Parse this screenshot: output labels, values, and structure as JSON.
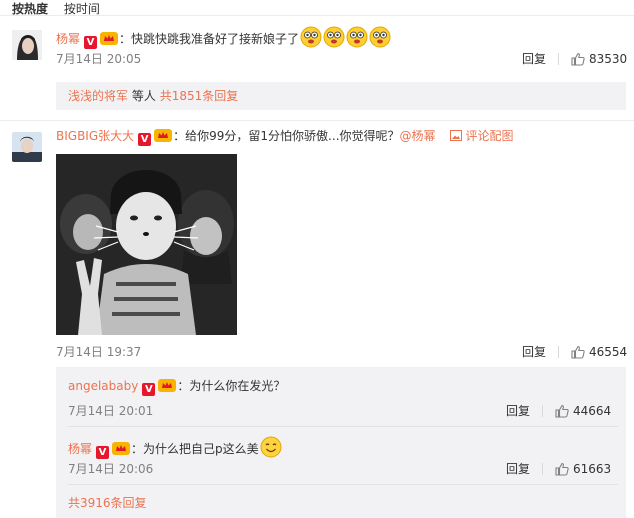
{
  "sort": {
    "hot": "按热度",
    "time": "按时间"
  },
  "comment1": {
    "author": "杨幂",
    "text": "：快跳快跳我准备好了接新娘子了",
    "time": "7月14日 20:05",
    "reply_label": "回复",
    "likes": "83530",
    "summary_user": "浅浅的将军",
    "summary_mid": "等人",
    "summary_count": "共1851条回复"
  },
  "comment2": {
    "author": "BIGBIG张大大",
    "text": "：给你99分，留1分怕你骄傲...你觉得呢？",
    "mention": "@杨幂",
    "pic_link": "评论配图",
    "time": "7月14日 19:37",
    "reply_label": "回复",
    "likes": "46554",
    "replies": [
      {
        "author": "angelababy",
        "text": "：为什么你在发光？",
        "time": "7月14日 20:01",
        "reply_label": "回复",
        "likes": "44664"
      },
      {
        "author": "杨幂",
        "text": "：为什么把自己p这么美",
        "time": "7月14日 20:06",
        "reply_label": "回复",
        "likes": "61663"
      }
    ],
    "more_replies": "共3916条回复"
  },
  "colors": {
    "link": "#eb7350",
    "badge": "#e6162d",
    "panel": "#f2f2f5",
    "meta": "#808080"
  }
}
